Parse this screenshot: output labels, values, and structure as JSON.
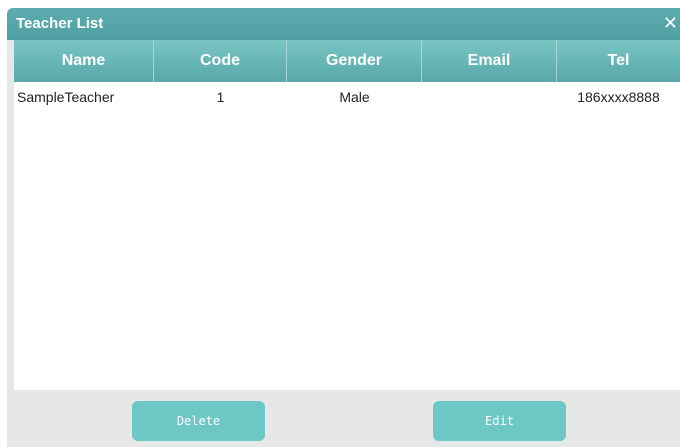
{
  "window": {
    "title": "Teacher List",
    "close_glyph": "✕"
  },
  "table": {
    "columns": [
      "Name",
      "Code",
      "Gender",
      "Email",
      "Tel"
    ],
    "rows": [
      {
        "name": "SampleTeacher",
        "code": "1",
        "gender": "Male",
        "email": "",
        "tel": "186xxxx8888"
      }
    ]
  },
  "buttons": {
    "delete": "Delete",
    "edit": "Edit"
  },
  "colors": {
    "titlebar": "#5aa8aa",
    "header": "#68b7b7",
    "button": "#6cc7c5",
    "background": "#e6e8e8"
  }
}
